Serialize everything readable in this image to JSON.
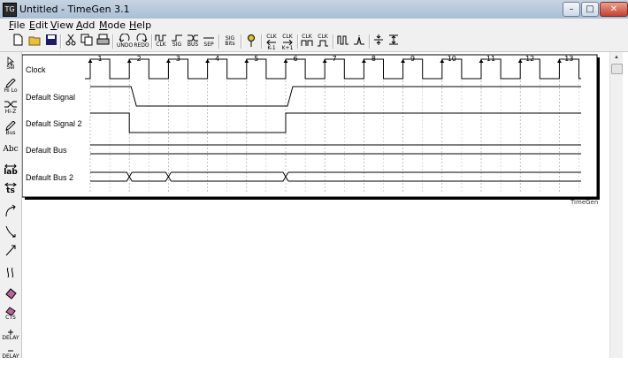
{
  "window": {
    "title": "Untitled - TimeGen 3.1",
    "app_icon": "tg-app-icon"
  },
  "window_buttons": {
    "minimize": "–",
    "maximize": "□",
    "close": "✕"
  },
  "menu": [
    {
      "label": "File"
    },
    {
      "label": "Edit"
    },
    {
      "label": "View"
    },
    {
      "label": "Add"
    },
    {
      "label": "Mode"
    },
    {
      "label": "Help"
    }
  ],
  "toolbar": {
    "undo_label": "UNDO",
    "redo_label": "REDO",
    "add_clk_label": "CLK",
    "add_sig_label": "SIG",
    "add_bus_label": "BUS",
    "add_sep_label": "SEP",
    "sig_bits_label": "SIG Bits",
    "clk_label_1": "CLK",
    "clk_label_2": "CLK",
    "clk_label_3": "CLK",
    "clk_label_4": "CLK",
    "k1_label": "K-1",
    "k1b_label": "K+1"
  },
  "tools": {
    "sel": "Sel",
    "hilo": "Hi Lo",
    "hiz": "Hi-Z",
    "bus": "Bus",
    "abc": "Abc",
    "lab": "lab",
    "ts": "ts",
    "cts": "CTS",
    "plus_delay": "DELAY",
    "minus_delay": "DELAY"
  },
  "diagram": {
    "brand": "TimeGen",
    "clock_cycle_labels": [
      "1",
      "2",
      "3",
      "4",
      "5",
      "6",
      "7",
      "8",
      "9",
      "10",
      "11",
      "12",
      "13"
    ],
    "signals": [
      {
        "name": "Clock",
        "type": "clock"
      },
      {
        "name": "Default Signal",
        "type": "signal",
        "low_from_cycle": 2,
        "low_to_cycle": 6
      },
      {
        "name": "Default Signal 2",
        "type": "signal",
        "low_from_cycle": 2,
        "low_to_cycle": 6
      },
      {
        "name": "Default Bus",
        "type": "bus",
        "transitions": []
      },
      {
        "name": "Default Bus 2",
        "type": "bus",
        "transitions": [
          2,
          3,
          6
        ]
      }
    ]
  }
}
